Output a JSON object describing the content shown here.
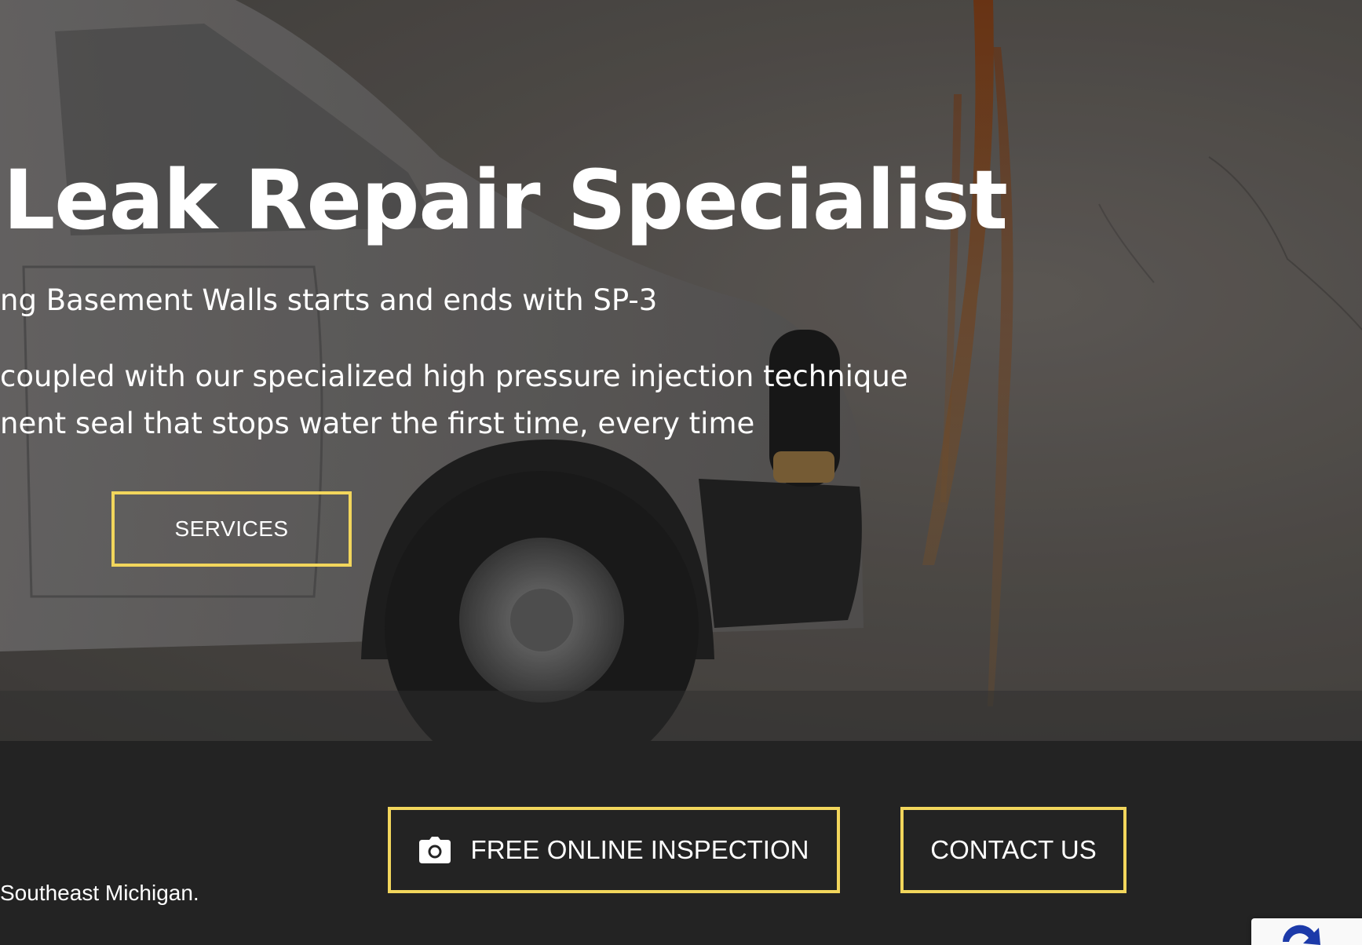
{
  "hero": {
    "title": "Leak Repair Specialist",
    "subtitle": "ng Basement Walls starts and ends with SP-3",
    "body_line_1": "coupled with our specialized high pressure injection technique",
    "body_line_2": "nent seal that stops water the first time, every time",
    "services_button": "SERVICES"
  },
  "actions": {
    "inspection_button": "FREE ONLINE INSPECTION",
    "inspection_icon": "camera-icon",
    "contact_button": "CONTACT US"
  },
  "footer": {
    "note": "Southeast Michigan."
  },
  "colors": {
    "accent": "#f2d65c",
    "bar_background": "#232323",
    "text": "#ffffff"
  }
}
